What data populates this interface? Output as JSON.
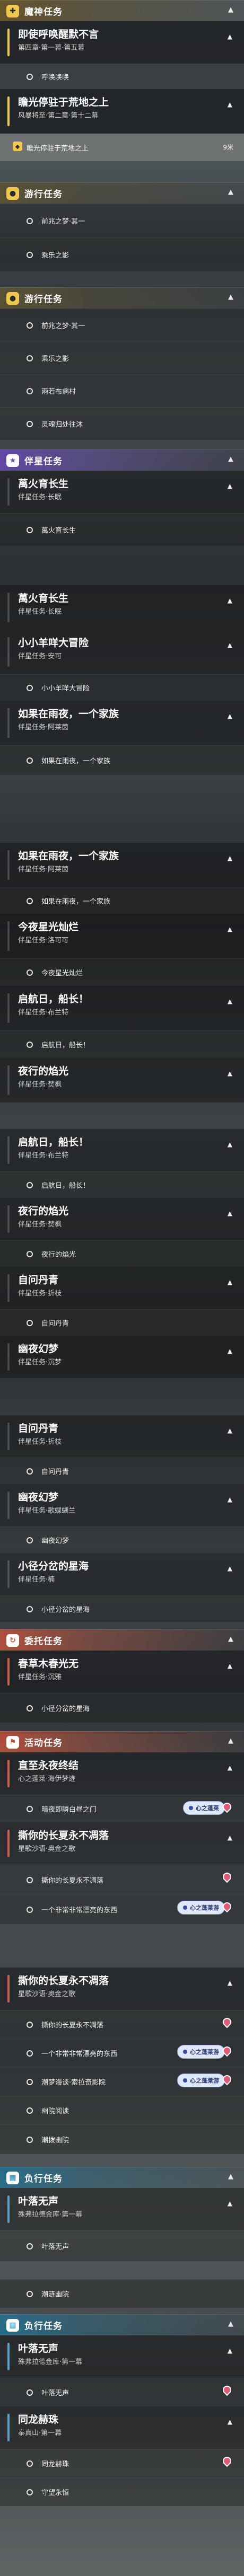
{
  "colors": {
    "main": "#f0c850",
    "companion": "#6a4fb0",
    "red": "#c2533a",
    "blue": "#2c7ea0",
    "pin": "#e05a78"
  },
  "block1": {
    "cat": {
      "label": "魔神任务",
      "icon": "plus-icon",
      "arrow": "▲"
    },
    "q1": {
      "title": "即使呼唤醒默不言",
      "sub": "第四章·第一幕·第五幕"
    },
    "o1": "呼唤唤唤",
    "q2": {
      "title": "瞻光停驻于荒地之上",
      "sub": "风暴将至·第二章·第十二幕"
    },
    "o2": {
      "text": "瞻光停驻于荒地之上",
      "extra": "9米"
    }
  },
  "block2": {
    "cat": {
      "label": "游行任务",
      "arrow": "▲"
    },
    "items": [
      "前兆之梦·其一",
      "乘乐之影"
    ]
  },
  "block3": {
    "cat": {
      "label": "游行任务",
      "arrow": "▲"
    },
    "items": [
      "前兆之梦·其一",
      "乘乐之影",
      "雨若布病村",
      "灵魂归处往沐"
    ]
  },
  "block4": {
    "cat": {
      "label": "伴星任务",
      "arrow": "▲"
    },
    "q1": {
      "title": "萬火育长生",
      "sub": "伴星任务·长眠"
    },
    "o1": "萬火育长生"
  },
  "block5": {
    "q1": {
      "title": "萬火育长生",
      "sub": "伴星任务·长眠"
    },
    "q2": {
      "title": "小小羊咩大冒险",
      "sub": "伴星任务·安可"
    },
    "o1": "小小羊咩大冒险",
    "q3": {
      "title": "如果在雨夜，一个家族",
      "sub": "伴星任务·阿莱茵"
    },
    "o2": "如果在雨夜，一个家族"
  },
  "block6": {
    "q1": {
      "title": "如果在雨夜，一个家族",
      "sub": "伴星任务·阿莱茵"
    },
    "o1": "如果在雨夜，一个家族",
    "q2": {
      "title": "今夜星光灿烂",
      "sub": "伴星任务·洛可可"
    },
    "o2": "今夜星光灿烂",
    "q3": {
      "title": "启航日，船长！",
      "sub": "伴星任务·布兰特"
    },
    "o3": "启航日，船长！",
    "q4": {
      "title": "夜行的焰光",
      "sub": "伴星任务·焚枫"
    }
  },
  "block7": {
    "q1": {
      "title": "启航日，船长！",
      "sub": "伴星任务·布兰特"
    },
    "o1": "启航日，船长！",
    "q2": {
      "title": "夜行的焰光",
      "sub": "伴星任务·焚枫"
    },
    "o2": "夜行的焰光",
    "q3": {
      "title": "自问丹青",
      "sub": "伴星任务·折枝"
    },
    "o3": "自问丹青",
    "q4": {
      "title": "幽夜幻梦",
      "sub": "伴星任务·沉梦"
    }
  },
  "block8": {
    "q1": {
      "title": "自问丹青",
      "sub": "伴星任务·折枝"
    },
    "o1": "自问丹青",
    "q2": {
      "title": "幽夜幻梦",
      "sub": "伴星任务·歌蝶蝴兰"
    },
    "o2": "幽夜幻梦",
    "q3": {
      "title": "小径分岔的星海",
      "sub": "伴星任务·楠"
    },
    "o3": "小径分岔的星海"
  },
  "block9": {
    "cat": {
      "label": "委托任务",
      "arrow": "▲"
    },
    "q1": {
      "title": "春草木春光无",
      "sub": "伴星任务·沉雅"
    },
    "o1": "小径分岔的星海"
  },
  "block10": {
    "cat": {
      "label": "活动任务",
      "arrow": "▲"
    },
    "q1": {
      "title": "直至永夜终结",
      "sub": "心之蓬莱·海伊梦迹"
    },
    "o1": {
      "text": "暗夜即瞬白昼之门",
      "badge": "心之蓬莱"
    },
    "q2": {
      "title": "撕你的长夏永不凋落",
      "sub": "星歌沙语·奥金之歌"
    },
    "o2": "撕你的长夏永不凋落",
    "o3": {
      "text": "一个非常非常漂亮的东西",
      "badge": "心之蓬莱游"
    }
  },
  "block11": {
    "q1": {
      "title": "撕你的长夏永不凋落",
      "sub": "星歌沙语·奥金之歌"
    },
    "o1": "撕你的长夏永不凋落",
    "o2": {
      "text": "一个非常非常漂亮的东西",
      "badge": "心之蓬莱游"
    },
    "o3": {
      "text": "潮梦海谈·索拉奇影院",
      "badge": "心之蓬莱游"
    },
    "o4": "幽院阅读",
    "o5": "潮拨幽院"
  },
  "block12": {
    "cat": {
      "label": "负行任务",
      "arrow": "▲"
    },
    "q1": {
      "title": "叶落无声",
      "sub": "殊弗拉德金库·第一幕"
    },
    "o1": "叶落无声"
  },
  "block13": {
    "o1": "潮涟幽院",
    "cat": {
      "label": "负行任务",
      "arrow": "▲"
    },
    "q1": {
      "title": "叶落无声",
      "sub": "殊弗拉德金库·第一幕"
    },
    "o2": "叶落无声",
    "q2": {
      "title": "同龙赫珠",
      "sub": "泰真山·第一幕"
    },
    "o3": "同龙赫珠",
    "o4": "守望永恒"
  }
}
